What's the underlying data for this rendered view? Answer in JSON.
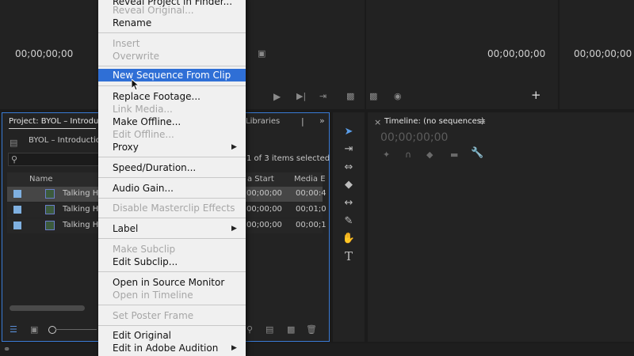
{
  "monitors": {
    "source_timecode_left": "00;00;00;00",
    "source_timecode_right": "00;00;00;00",
    "program_timecode": "00;00;00;00"
  },
  "project_panel": {
    "tab_label": "Project: BYOL – Introductio",
    "libraries_tab": "Libraries",
    "bin_name": "BYOL – Introductio",
    "selection_status": "1 of 3 items selected",
    "columns": [
      "Name",
      "a Start",
      "Media E"
    ],
    "rows": [
      {
        "name": "Talking He",
        "media_start": "00;00;00",
        "media_end": "00;00:4"
      },
      {
        "name": "Talking He",
        "media_start": "00;00;00",
        "media_end": "00;01;0"
      },
      {
        "name": "Talking He",
        "media_start": "00;00;00",
        "media_end": "00;00;1"
      }
    ]
  },
  "timeline": {
    "title": "Timeline: (no sequences)",
    "timecode": "00;00;00;00"
  },
  "context_menu": {
    "items": [
      {
        "label": "Reveal Project in Finder...",
        "state": "enabled"
      },
      {
        "label": "Reveal Original...",
        "state": "disabled"
      },
      {
        "label": "Rename",
        "state": "enabled"
      },
      {
        "label": "Insert",
        "state": "disabled"
      },
      {
        "label": "Overwrite",
        "state": "disabled"
      },
      {
        "label": "New Sequence From Clip",
        "state": "highlighted"
      },
      {
        "label": "Replace Footage...",
        "state": "enabled"
      },
      {
        "label": "Link Media...",
        "state": "disabled"
      },
      {
        "label": "Make Offline...",
        "state": "enabled"
      },
      {
        "label": "Edit Offline...",
        "state": "disabled"
      },
      {
        "label": "Proxy",
        "state": "enabled",
        "submenu": true
      },
      {
        "label": "Speed/Duration...",
        "state": "enabled"
      },
      {
        "label": "Audio Gain...",
        "state": "enabled"
      },
      {
        "label": "Disable Masterclip Effects",
        "state": "disabled"
      },
      {
        "label": "Label",
        "state": "enabled",
        "submenu": true
      },
      {
        "label": "Make Subclip",
        "state": "disabled"
      },
      {
        "label": "Edit Subclip...",
        "state": "enabled"
      },
      {
        "label": "Open in Source Monitor",
        "state": "enabled"
      },
      {
        "label": "Open in Timeline",
        "state": "disabled"
      },
      {
        "label": "Set Poster Frame",
        "state": "disabled"
      },
      {
        "label": "Edit Original",
        "state": "enabled"
      },
      {
        "label": "Edit in Adobe Audition",
        "state": "enabled",
        "submenu": true
      }
    ]
  },
  "colors": {
    "highlight": "#2f6fd6",
    "panel_focus": "#3a7bd5",
    "label_blue": "#7fb0e0"
  }
}
